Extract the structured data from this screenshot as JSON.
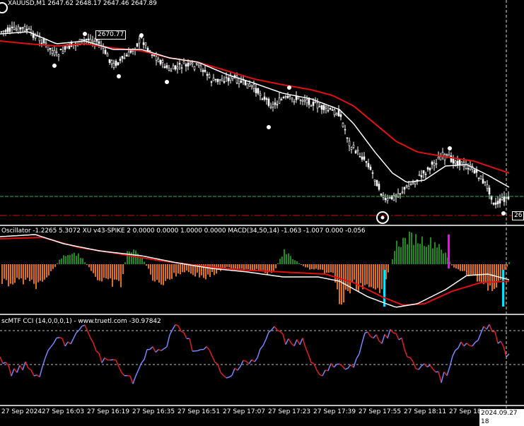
{
  "symbol_header": "XAUUSD,M1  2647.62 2648.17 2647.46 2647.89",
  "price_tag": "2670.77",
  "right_price_tag": "26",
  "indicator1_header": "Oscillator -1.2265 5.3072  XU v43-SPIKE 2 0.0000 0.0000 1.0000 0.0000  MACD(34,50,14) -1.063 -1.007 0.000 -0.056",
  "indicator2_header": "scMTF CCI (14,0,0,0,1) - www.truetl.com -30.97842",
  "time_labels": [
    "27 Sep 2024",
    "27 Sep 16:03",
    "27 Sep 16:19",
    "27 Sep 16:35",
    "27 Sep 16:51",
    "27 Sep 17:07",
    "27 Sep 17:23",
    "27 Sep 17:39",
    "27 Sep 17:55",
    "27 Sep 18:11",
    "27 Sep 18"
  ],
  "cursor_timestamp": "2024.09.27 18",
  "colors": {
    "background": "#000000",
    "candle": "#ffffff",
    "fast_ma": "#ffffff",
    "slow_ma": "#e01010",
    "bid_line": "#2fb34a",
    "stop_line": "#d01010",
    "hist_pos": "#1f8a1f",
    "hist_neg": "#e07020",
    "spike_magenta": "#ff00ff",
    "spike_cyan": "#00e5ff",
    "cci_up": "#7b84ff",
    "cci_down": "#e02020"
  }
}
